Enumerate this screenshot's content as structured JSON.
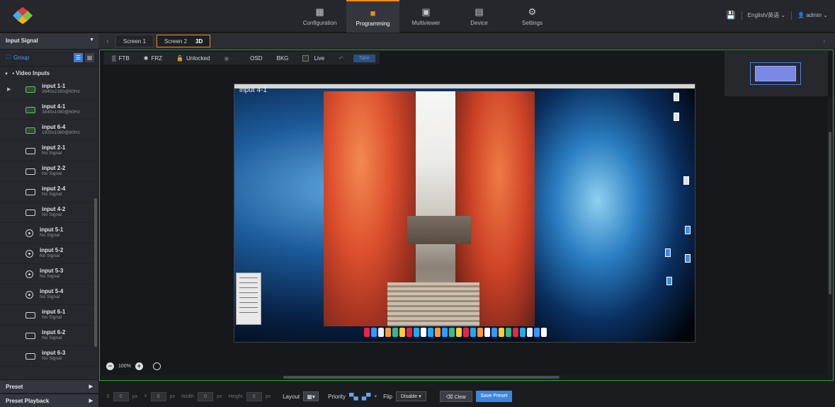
{
  "topbar": {
    "tabs": [
      {
        "label": "Configuration",
        "icon": "grid-icon"
      },
      {
        "label": "Programming",
        "icon": "layers-icon",
        "active": true
      },
      {
        "label": "Multiviewer",
        "icon": "monitor-icon"
      },
      {
        "label": "Device",
        "icon": "device-icon"
      },
      {
        "label": "Settings",
        "icon": "gear-icon"
      }
    ],
    "language": "English/英语",
    "user": "admin"
  },
  "sidebar": {
    "header": "Input Signal",
    "group_label": "Group",
    "video_inputs_label": "Video Inputs",
    "inputs": [
      {
        "name": "input 1-1",
        "status": "3840x2160@60Hz",
        "type": "hdmi-green-outline"
      },
      {
        "name": "input 4-1",
        "status": "3840x1080@60Hz",
        "type": "hdmi-green-outline"
      },
      {
        "name": "input 6-4",
        "status": "1920x1080@60Hz",
        "type": "green"
      },
      {
        "name": "input 2-1",
        "status": "No Signal",
        "type": "hdmi"
      },
      {
        "name": "input 2-2",
        "status": "No Signal",
        "type": "hdmi"
      },
      {
        "name": "input 2-4",
        "status": "No Signal",
        "type": "hdmi"
      },
      {
        "name": "input 4-2",
        "status": "No Signal",
        "type": "hdmi"
      },
      {
        "name": "input 5-1",
        "status": "No Signal",
        "type": "circle"
      },
      {
        "name": "input 5-2",
        "status": "No Signal",
        "type": "circle"
      },
      {
        "name": "input 5-3",
        "status": "No Signal",
        "type": "circle"
      },
      {
        "name": "input 5-4",
        "status": "No Signal",
        "type": "circle"
      },
      {
        "name": "input 6-1",
        "status": "No Signal",
        "type": "dvi"
      },
      {
        "name": "input 6-2",
        "status": "No Signal",
        "type": "dvi"
      },
      {
        "name": "input 6-3",
        "status": "No Signal",
        "type": "dvi"
      }
    ],
    "preset_label": "Preset",
    "preset_playback_label": "Preset Playback"
  },
  "screens": {
    "tab1": "Screen 1",
    "tab2": "Screen 2",
    "tab2_badge": "3D"
  },
  "toolbar": {
    "ftb": "FTB",
    "frz": "FRZ",
    "unlocked": "Unlocked",
    "osd": "OSD",
    "bkg": "BKG",
    "live": "Live",
    "take": "Take"
  },
  "canvas": {
    "layer_label": "input 4-1",
    "zoom": "100%"
  },
  "bottom": {
    "x_label": "X",
    "x_value": "0",
    "y_label": "Y",
    "y_value": "0",
    "width_label": "Width",
    "width_value": "0",
    "height_label": "Height",
    "height_value": "0",
    "unit": "px",
    "layout_label": "Layout",
    "priority_label": "Priority",
    "flip_label": "Flip",
    "flip_value": "Disable",
    "clear_label": "Clear",
    "save_preset_label": "Save Preset"
  },
  "colors": {
    "accent": "#f28a1e",
    "canvas_border": "#2ba82b",
    "primary_button": "#3d86e0"
  }
}
